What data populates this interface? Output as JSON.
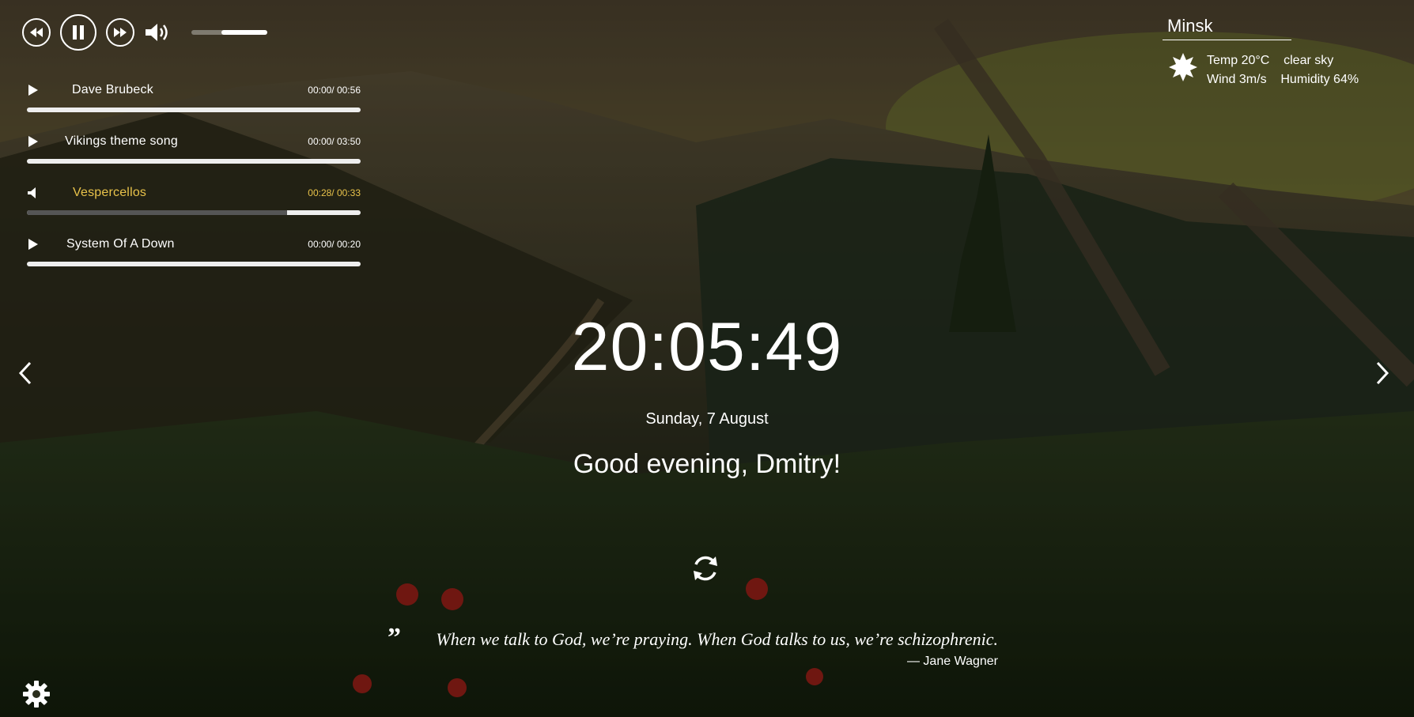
{
  "player": {
    "volume_level": 0.6,
    "controls": [
      "rewind-icon",
      "pause-icon",
      "fast-forward-icon",
      "volume-icon"
    ]
  },
  "playlist": [
    {
      "title": "Dave Brubeck",
      "time": "00:00/ 00:56",
      "progress": 0,
      "active": false
    },
    {
      "title": "Vikings theme song",
      "time": "00:00/ 03:50",
      "progress": 0,
      "active": false
    },
    {
      "title": "Vespercellos",
      "time": "00:28/ 00:33",
      "progress": 0.78,
      "active": true
    },
    {
      "title": "System Of A Down",
      "time": "00:00/ 00:20",
      "progress": 0,
      "active": false
    }
  ],
  "weather": {
    "city": "Minsk",
    "temp": "Temp 20°C",
    "description": "clear sky",
    "wind": "Wind 3m/s",
    "humidity": "Humidity 64%",
    "icon": "sun-icon"
  },
  "clock": {
    "time": "20:05:49",
    "date": "Sunday, 7 August"
  },
  "greeting": "Good evening, Dmitry!",
  "quote": {
    "text": "When we talk to God, we’re praying. When God talks to us, we’re schizophrenic.",
    "author": "— Jane Wagner"
  },
  "colors": {
    "accent": "#e8c24a",
    "text": "#ffffff"
  }
}
